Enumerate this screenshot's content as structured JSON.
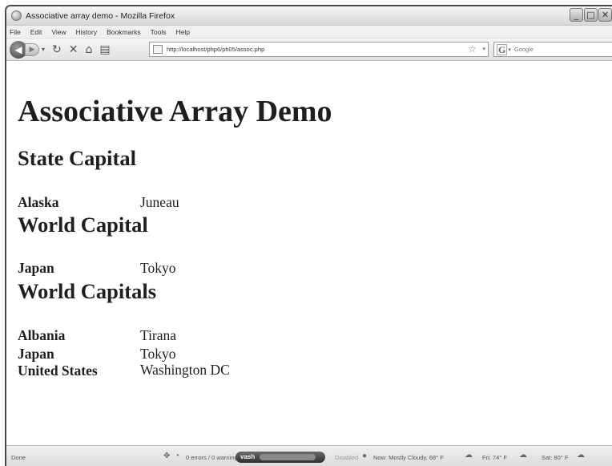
{
  "window": {
    "title": "Associative array demo - Mozilla Firefox",
    "controls": [
      "_",
      "□",
      "✕"
    ]
  },
  "menu": [
    "File",
    "Edit",
    "View",
    "History",
    "Bookmarks",
    "Tools",
    "Help"
  ],
  "navbar": {
    "url": "http://localhost/php6/ph05/assoc.php",
    "search_placeholder": "Google",
    "icons": [
      "back-icon",
      "forward-icon",
      "reload-icon",
      "stop-icon",
      "home-icon",
      "bookmark-add-icon",
      "star-icon",
      "google-icon",
      "search-icon"
    ]
  },
  "page": {
    "heading": "Associative Array Demo",
    "sections": [
      {
        "title": "State Capital",
        "rows": [
          {
            "key": "Alaska",
            "value": "Juneau"
          }
        ]
      },
      {
        "title": "World Capital",
        "rows": [
          {
            "key": "Japan",
            "value": "Tokyo"
          }
        ]
      },
      {
        "title": "World Capitals",
        "rows": [
          {
            "key": "Albania",
            "value": "Tirana"
          },
          {
            "key": "Japan",
            "value": "Tokyo"
          },
          {
            "key": "United States",
            "value": "Washington DC"
          }
        ]
      }
    ]
  },
  "status": {
    "left": "Done",
    "errors": "0 errors / 0 warnings",
    "vash": "vash",
    "disabled": "Disabled",
    "weather_now": "Now: Mostly Cloudy, 68° F",
    "fri": "Fri: 74° F",
    "sat": "Sat: 80° F"
  }
}
